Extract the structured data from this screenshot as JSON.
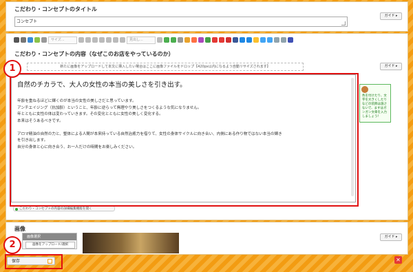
{
  "section_title": {
    "label": "こだわり・コンセプトのタイトル",
    "input_value": "コンセプト",
    "guide_label": "ガイド ▸"
  },
  "section_content": {
    "label": "こだわり・コンセプトの内容（なぜこのお店をやっているのか）",
    "guide_label": "ガイド ▸",
    "toolbar": {
      "style_select": "サイズ...",
      "format_select": "見出し..."
    },
    "dropzone_text": "新たに画像をアップロードして本文に挿入したい場合はここに画像ファイルをドロップ【420px以内になるよう自動リサイズされます】",
    "editor": {
      "heading": "自然のチカラで、大人の女性の本当の美しさを引き出す。",
      "lines": [
        "年齢を重ねるほどに輝くのが本当の女性の美しさだと思っています。",
        "アンチエイジング（抗加齢）ということ、年齢に逆らって無理やり美しさをつくるような気になりません。",
        "年とともに女性の体は変わっていきます。その変化とともに女性の美しく変化する。",
        "本来はそうあるべきです。",
        "",
        "アロマ精油の自然の力と、整体による人間が本来持っている自然治癒力を借りて、女性の身体サイクルに向き合い、内側にある作り物ではない本当の輝き",
        "を引き出します。",
        "自分の身体と心に向き合う、お一人だけの時間をお楽しみください。"
      ]
    },
    "tip_text": "色を付けたり、文字を大きくしたりなどの装飾は施さないで、ますはガンガン文章を入力しましょう！",
    "toggle_label": "こだわり・コンセプトの内容の詳細編集機能を開く"
  },
  "section_image": {
    "label": "画像",
    "guide_label": "ガイド ▸",
    "select_label": "画像選択",
    "upload_label": "画像をアップロード/選択"
  },
  "annotations": {
    "marker_1": "1",
    "marker_2": "2"
  },
  "footer": {
    "save_label": "保存",
    "lock_icon": "lock-icon",
    "trash_icon": "trash-icon"
  },
  "colors": {
    "accent": "#f5a623",
    "highlight": "#e01010",
    "tip_green": "#5cb85c"
  }
}
